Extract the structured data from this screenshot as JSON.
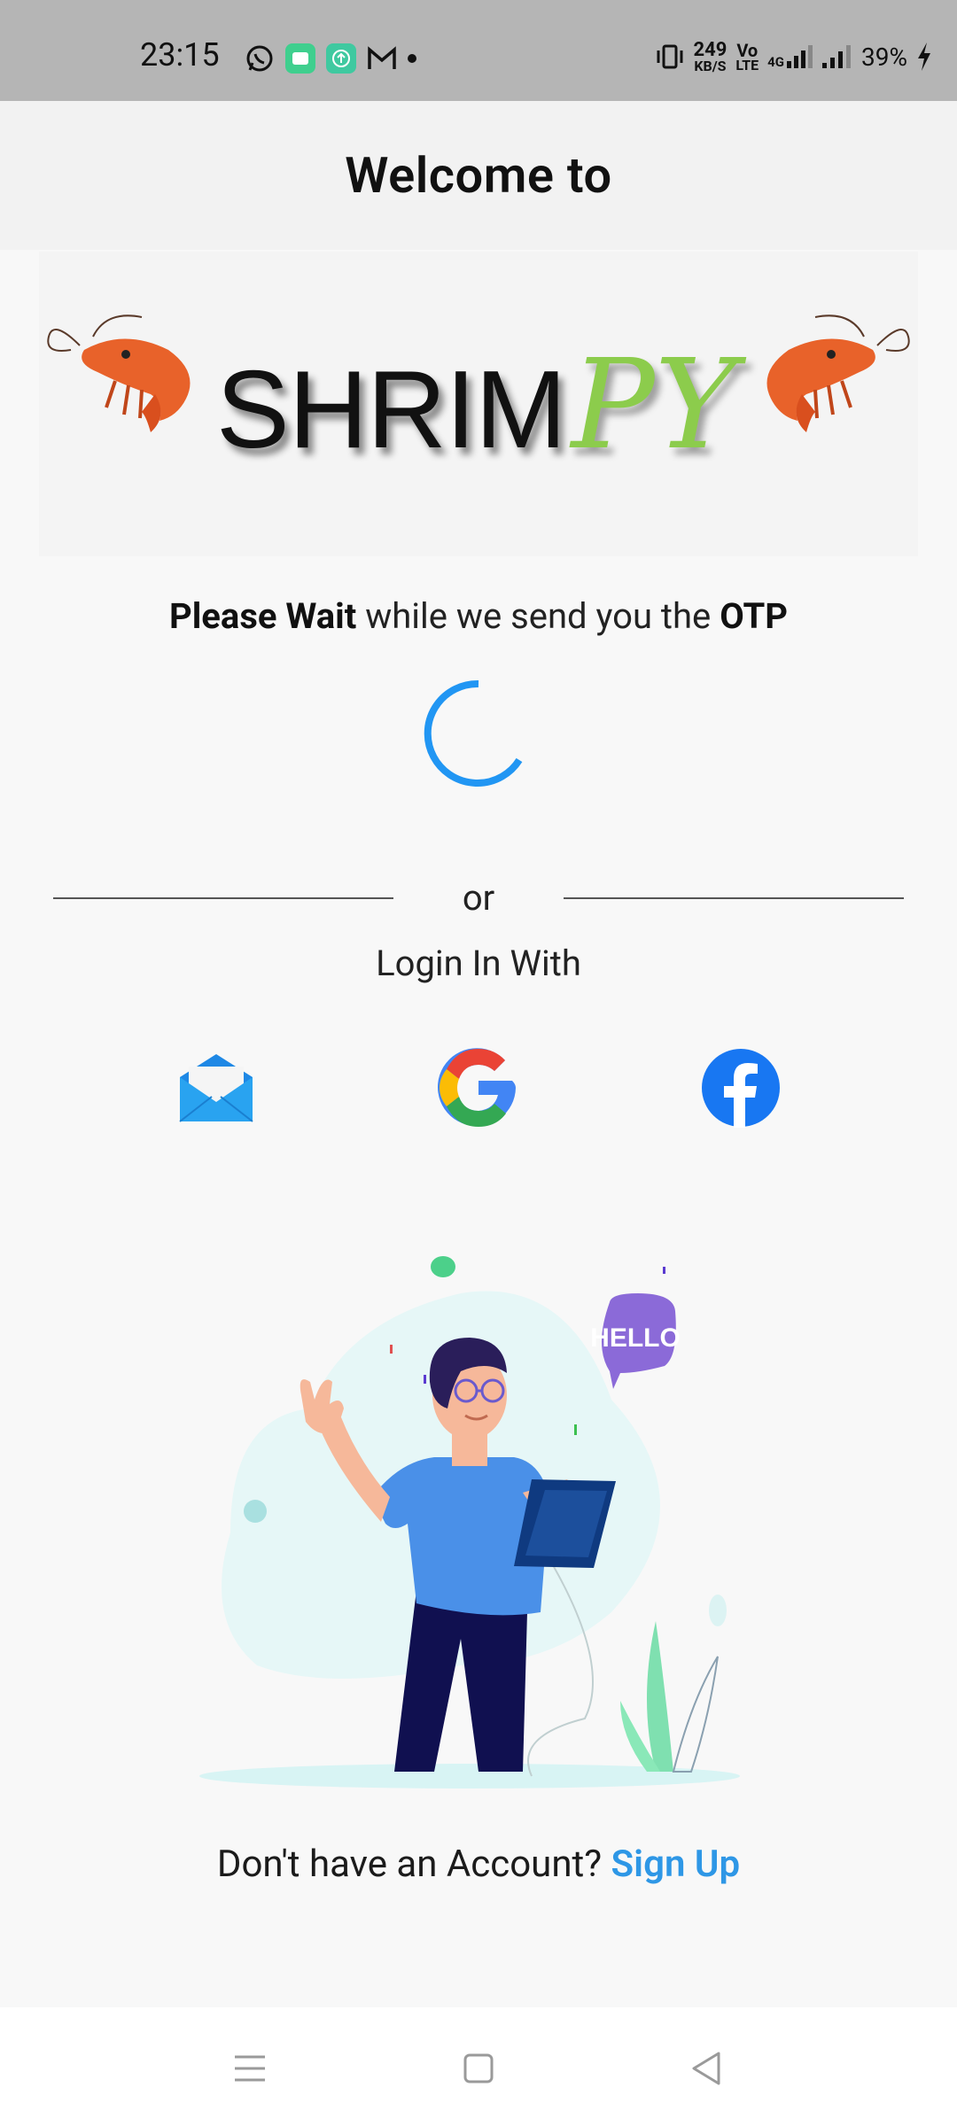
{
  "status_bar": {
    "time": "23:15",
    "speed_value": "249",
    "speed_unit": "KB/S",
    "volte_top": "Vo",
    "volte_bottom": "LTE",
    "network": "4G",
    "battery": "39%",
    "icons": [
      "whatsapp-icon",
      "app-green-icon",
      "upload-icon",
      "gmail-icon",
      "dot-icon",
      "vibrate-icon",
      "signal-icon",
      "signal-icon-2",
      "charging-icon"
    ]
  },
  "header": {
    "title": "Welcome to"
  },
  "logo": {
    "text_main": "SHRIM",
    "text_accent": "PY",
    "accent_color": "#8ccc4c"
  },
  "otp": {
    "bold_start": "Please Wait",
    "middle": " while we send you the ",
    "bold_end": "OTP"
  },
  "divider": {
    "text": "or"
  },
  "login": {
    "title": "Login In With",
    "providers": [
      "email-icon",
      "google-icon",
      "facebook-icon"
    ]
  },
  "illustration": {
    "bubble_text": "HELLO"
  },
  "signup": {
    "prompt": "Don't have an Account? ",
    "link": "Sign Up",
    "link_color": "#2e97e6"
  },
  "nav": {
    "icons": [
      "menu-icon",
      "home-icon",
      "back-icon"
    ]
  }
}
